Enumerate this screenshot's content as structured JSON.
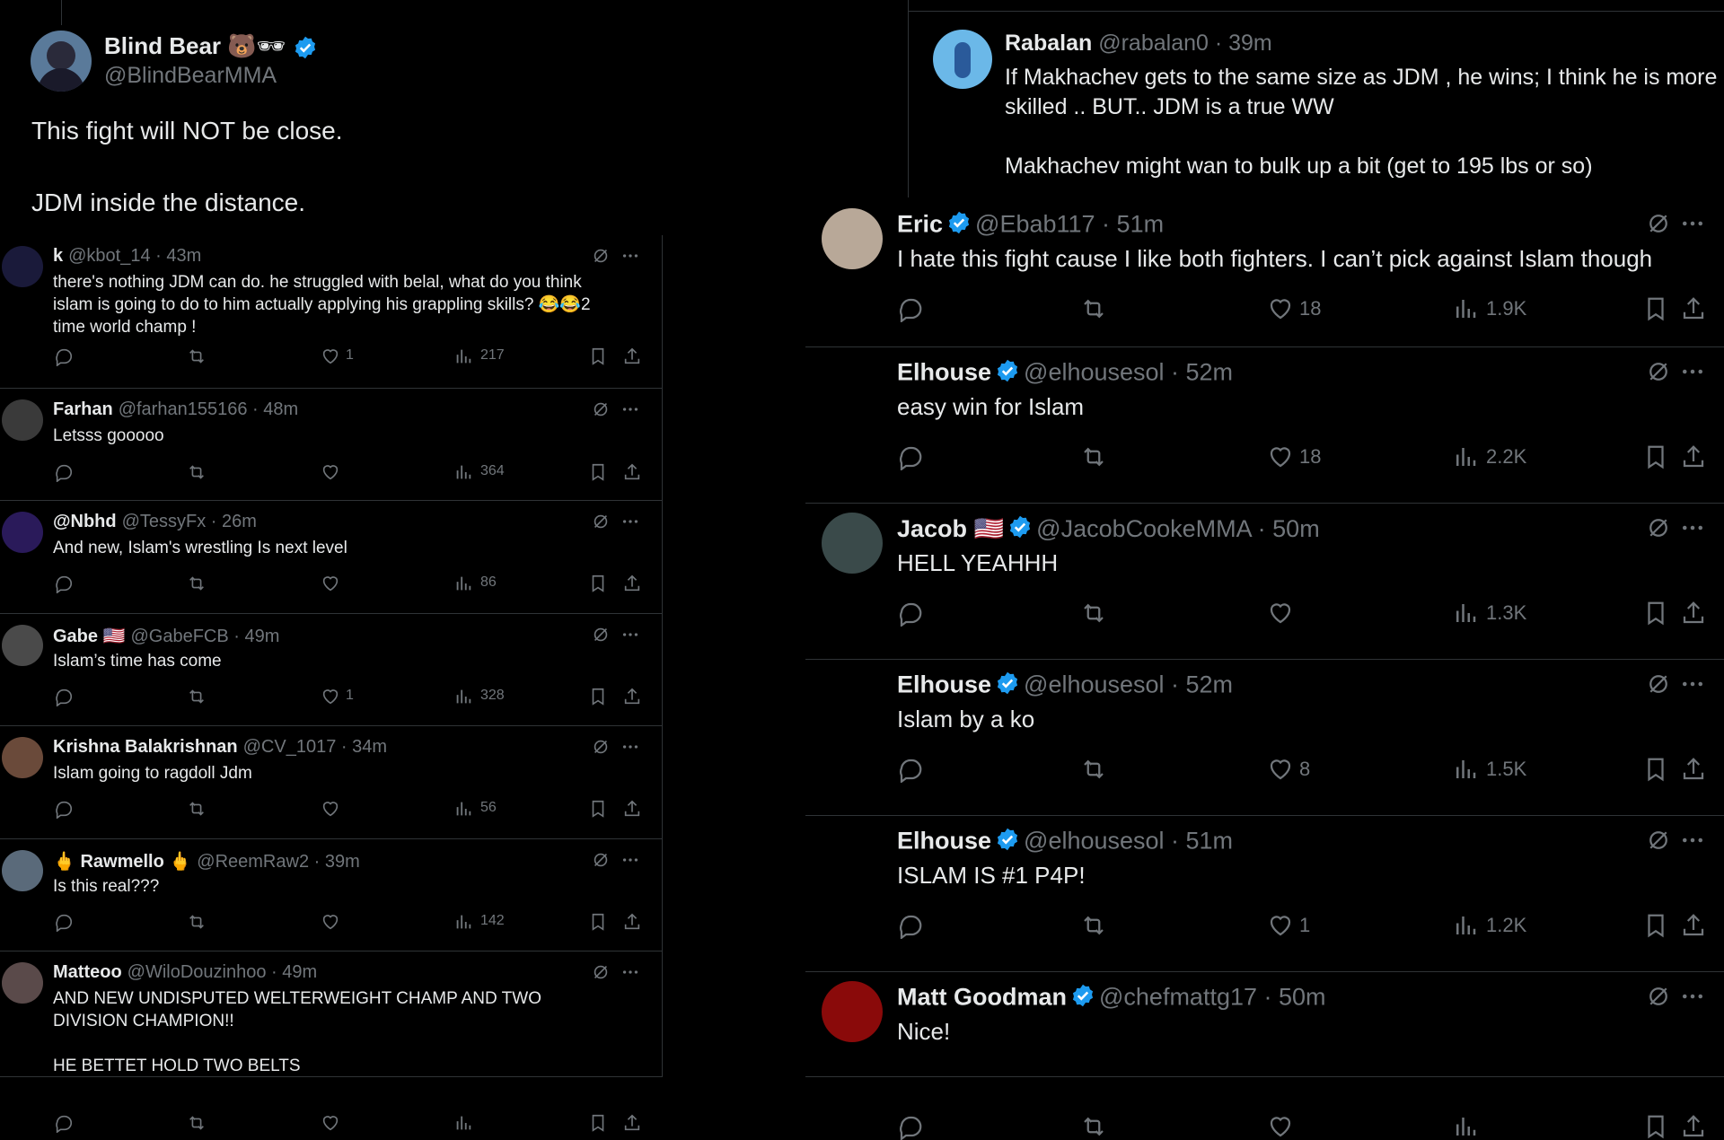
{
  "main_post": {
    "name": "Blind Bear",
    "emoji": "🐻🕶",
    "handle": "@BlindBearMMA",
    "text_line1": "This fight will NOT be close.",
    "text_line2": "JDM inside the distance."
  },
  "quoted_reply": {
    "name": "Rabalan",
    "meta": "@rabalan0 · 39m",
    "text": "If Makhachev gets to the same size as JDM , he wins; I think he is more skilled .. BUT.. JDM is a true WW",
    "text2": "Makhachev might wan to bulk up a bit (get to 195 lbs or so)"
  },
  "left_replies": [
    {
      "name": "k",
      "meta": "@kbot_14 · 43m",
      "text": "there's nothing JDM can do. he struggled with belal, what do you think islam is going to do to him actually applying his grappling skills? 😂😂2 time world champ !",
      "likes": "1",
      "views": "217",
      "avatar_color": "#1a1a3a"
    },
    {
      "name": "Farhan",
      "meta": "@farhan155166 · 48m",
      "text": "Letsss gooooo",
      "likes": "",
      "views": "364",
      "avatar_color": "#3a3a3a"
    },
    {
      "name": "@Nbhd",
      "meta": "@TessyFx · 26m",
      "text": "And new, Islam's wrestling Is next level",
      "likes": "",
      "views": "86",
      "avatar_color": "#2a1a5a"
    },
    {
      "name": "Gabe 🇺🇸",
      "meta": "@GabeFCB · 49m",
      "text": "Islam’s time has come",
      "likes": "1",
      "views": "328",
      "avatar_color": "#4a4a4a"
    },
    {
      "name": "Krishna Balakrishnan",
      "meta": "@CV_1017 · 34m",
      "text": "Islam going to ragdoll Jdm",
      "likes": "",
      "views": "56",
      "avatar_color": "#6a4a3a"
    },
    {
      "name": "🖕 Rawmello 🖕",
      "meta": "@ReemRaw2 · 39m",
      "text": "Is this real???",
      "likes": "",
      "views": "142",
      "avatar_color": "#5a6a7a"
    },
    {
      "name": "Matteoo",
      "meta": "@WiloDouzinhoo · 49m",
      "text": "AND NEW UNDISPUTED WELTERWEIGHT CHAMP AND TWO DIVISION CHAMPION!!\n\nHE BETTET HOLD TWO BELTS",
      "likes": "",
      "views": "",
      "avatar_color": "#5a4a4a"
    }
  ],
  "right_replies": [
    {
      "name": "Eric",
      "meta": "@Ebab117 · 51m",
      "text": "I hate this fight cause I like both fighters. I can’t pick against Islam though",
      "likes": "18",
      "views": "1.9K",
      "avatar_color": "#b8a898"
    },
    {
      "name": "Elhouse",
      "meta": "@elhousesol · 52m",
      "text": "easy win for Islam",
      "likes": "18",
      "views": "2.2K",
      "avatar_color": "#000000"
    },
    {
      "name": "Jacob 🇺🇸",
      "meta": "@JacobCookeMMA · 50m",
      "text": "HELL YEAHHH",
      "likes": "",
      "views": "1.3K",
      "avatar_color": "#3a4a4a"
    },
    {
      "name": "Elhouse",
      "meta": "@elhousesol · 52m",
      "text": "Islam by a ko",
      "likes": "8",
      "views": "1.5K",
      "avatar_color": "#000000"
    },
    {
      "name": "Elhouse",
      "meta": "@elhousesol · 51m",
      "text": "ISLAM IS #1 P4P!",
      "likes": "1",
      "views": "1.2K",
      "avatar_color": "#000000"
    },
    {
      "name": "Matt Goodman",
      "meta": "@chefmattg17 · 50m",
      "text": "Nice!",
      "likes": "",
      "views": "",
      "avatar_color": "#8a0a0a"
    }
  ],
  "colors": {
    "accent": "#1d9bf0",
    "muted": "#71767b",
    "divider": "#2f3336",
    "text": "#e7e9ea"
  },
  "icons": [
    "reply-icon",
    "repost-icon",
    "like-icon",
    "views-icon",
    "bookmark-icon",
    "share-icon",
    "grok-icon",
    "more-icon",
    "verified-badge-icon"
  ]
}
